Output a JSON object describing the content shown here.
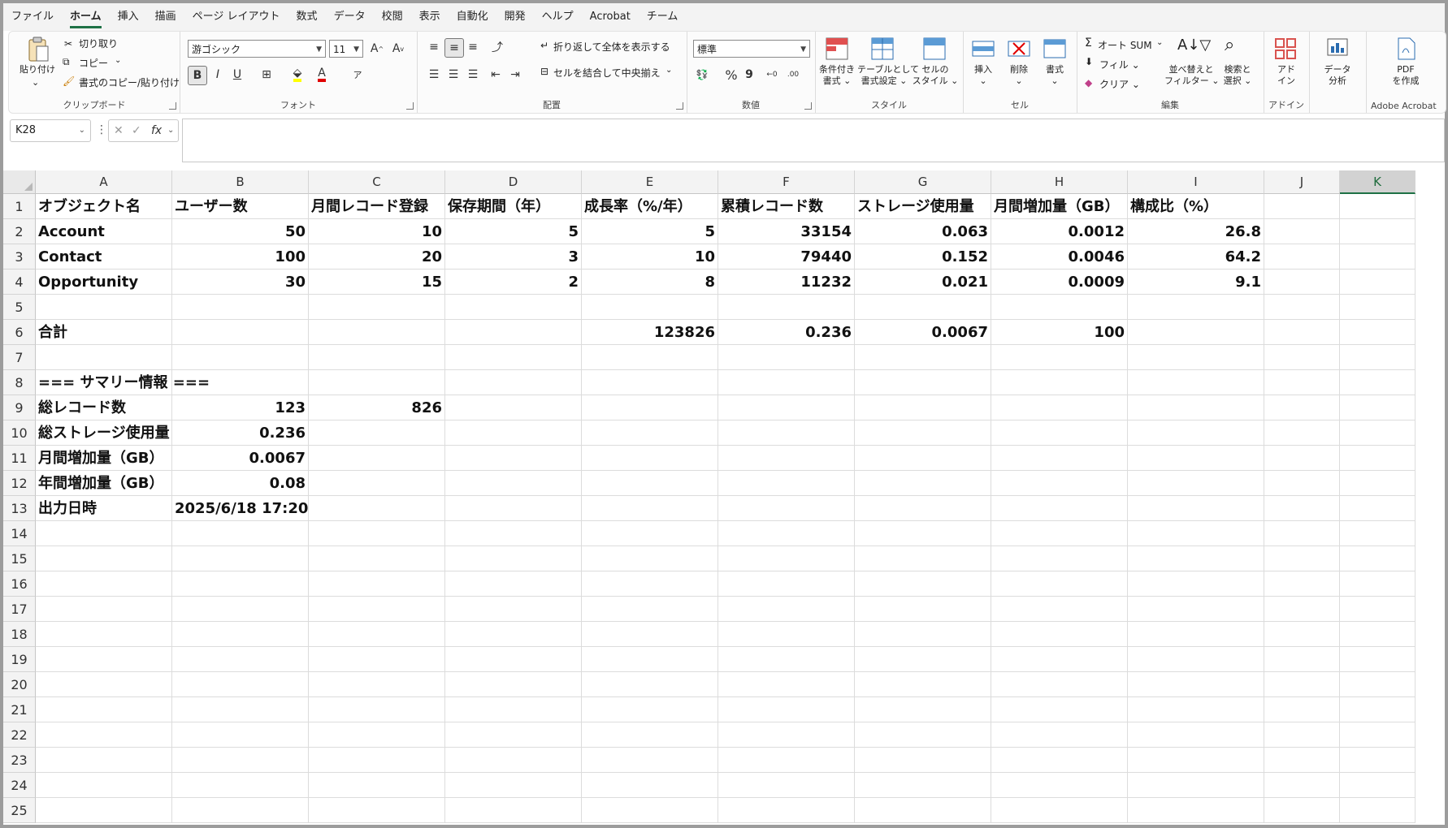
{
  "menu": [
    "ファイル",
    "ホーム",
    "挿入",
    "描画",
    "ページ レイアウト",
    "数式",
    "データ",
    "校閲",
    "表示",
    "自動化",
    "開発",
    "ヘルプ",
    "Acrobat",
    "チーム"
  ],
  "active_menu_index": 1,
  "ribbon": {
    "clipboard": {
      "paste": "貼り付け",
      "cut": "切り取り",
      "copy": "コピー",
      "format_painter": "書式のコピー/貼り付け",
      "label": "クリップボード"
    },
    "font": {
      "font_name": "游ゴシック",
      "font_size": "11",
      "bold": "B",
      "italic": "I",
      "underline": "U",
      "label": "フォント"
    },
    "alignment": {
      "wrap": "折り返して全体を表示する",
      "merge": "セルを結合して中央揃え",
      "label": "配置"
    },
    "number": {
      "format": "標準",
      "percent": "%",
      "comma": "9",
      "label": "数値"
    },
    "styles": {
      "conditional_l1": "条件付き",
      "conditional_l2": "書式",
      "table_l1": "テーブルとして",
      "table_l2": "書式設定",
      "cell_l1": "セルの",
      "cell_l2": "スタイル",
      "label": "スタイル"
    },
    "cells": {
      "insert": "挿入",
      "delete": "削除",
      "format": "書式",
      "label": "セル"
    },
    "editing": {
      "autosum": "オート SUM",
      "fill": "フィル",
      "clear": "クリア",
      "sort_l1": "並べ替えと",
      "sort_l2": "フィルター",
      "find_l1": "検索と",
      "find_l2": "選択",
      "label": "編集"
    },
    "addins": {
      "l1": "アド",
      "l2": "イン",
      "label": "アドイン"
    },
    "analyze": {
      "l1": "データ",
      "l2": "分析"
    },
    "acrobat": {
      "l1": "PDF",
      "l2": "を作成",
      "label": "Adobe Acrobat"
    }
  },
  "formula_bar": {
    "name_box": "K28",
    "fx": "fx",
    "content": ""
  },
  "columns": [
    "A",
    "B",
    "C",
    "D",
    "E",
    "F",
    "G",
    "H",
    "I",
    "J",
    "K"
  ],
  "selected_column": "K",
  "rows": [
    [
      "オブジェクト名",
      "ユーザー数",
      "月間レコード登録",
      "保存期間（年）",
      "成長率（%/年）",
      "累積レコード数",
      "ストレージ使用量",
      "月間増加量（GB）",
      "構成比（%）",
      "",
      ""
    ],
    [
      "Account",
      "50",
      "10",
      "5",
      "5",
      "33154",
      "0.063",
      "0.0012",
      "26.8",
      "",
      ""
    ],
    [
      "Contact",
      "100",
      "20",
      "3",
      "10",
      "79440",
      "0.152",
      "0.0046",
      "64.2",
      "",
      ""
    ],
    [
      "Opportunity",
      "30",
      "15",
      "2",
      "8",
      "11232",
      "0.021",
      "0.0009",
      "9.1",
      "",
      ""
    ],
    [
      "",
      "",
      "",
      "",
      "",
      "",
      "",
      "",
      "",
      "",
      ""
    ],
    [
      "合計",
      "",
      "",
      "",
      "123826",
      "0.236",
      "0.0067",
      "100",
      "",
      "",
      ""
    ],
    [
      "",
      "",
      "",
      "",
      "",
      "",
      "",
      "",
      "",
      "",
      ""
    ],
    [
      "=== サマリー情報 ===",
      "",
      "",
      "",
      "",
      "",
      "",
      "",
      "",
      "",
      ""
    ],
    [
      "総レコード数",
      "123",
      "826",
      "",
      "",
      "",
      "",
      "",
      "",
      "",
      ""
    ],
    [
      "総ストレージ使用量",
      "0.236",
      "",
      "",
      "",
      "",
      "",
      "",
      "",
      "",
      ""
    ],
    [
      "月間増加量（GB）",
      "0.0067",
      "",
      "",
      "",
      "",
      "",
      "",
      "",
      "",
      ""
    ],
    [
      "年間増加量（GB）",
      "0.08",
      "",
      "",
      "",
      "",
      "",
      "",
      "",
      "",
      ""
    ],
    [
      "出力日時",
      "2025/6/18 17:20",
      "",
      "",
      "",
      "",
      "",
      "",
      "",
      "",
      ""
    ],
    [
      "",
      "",
      "",
      "",
      "",
      "",
      "",
      "",
      "",
      "",
      ""
    ],
    [
      "",
      "",
      "",
      "",
      "",
      "",
      "",
      "",
      "",
      "",
      ""
    ],
    [
      "",
      "",
      "",
      "",
      "",
      "",
      "",
      "",
      "",
      "",
      ""
    ],
    [
      "",
      "",
      "",
      "",
      "",
      "",
      "",
      "",
      "",
      "",
      ""
    ],
    [
      "",
      "",
      "",
      "",
      "",
      "",
      "",
      "",
      "",
      "",
      ""
    ],
    [
      "",
      "",
      "",
      "",
      "",
      "",
      "",
      "",
      "",
      "",
      ""
    ],
    [
      "",
      "",
      "",
      "",
      "",
      "",
      "",
      "",
      "",
      "",
      ""
    ],
    [
      "",
      "",
      "",
      "",
      "",
      "",
      "",
      "",
      "",
      "",
      ""
    ],
    [
      "",
      "",
      "",
      "",
      "",
      "",
      "",
      "",
      "",
      "",
      ""
    ],
    [
      "",
      "",
      "",
      "",
      "",
      "",
      "",
      "",
      "",
      "",
      ""
    ],
    [
      "",
      "",
      "",
      "",
      "",
      "",
      "",
      "",
      "",
      "",
      ""
    ],
    [
      "",
      "",
      "",
      "",
      "",
      "",
      "",
      "",
      "",
      "",
      ""
    ]
  ],
  "colors": {
    "accent": "#1e7145",
    "header_bg": "#f3f3f3",
    "font_color_red": "#e00000",
    "highlight_yellow": "#ffff00"
  }
}
